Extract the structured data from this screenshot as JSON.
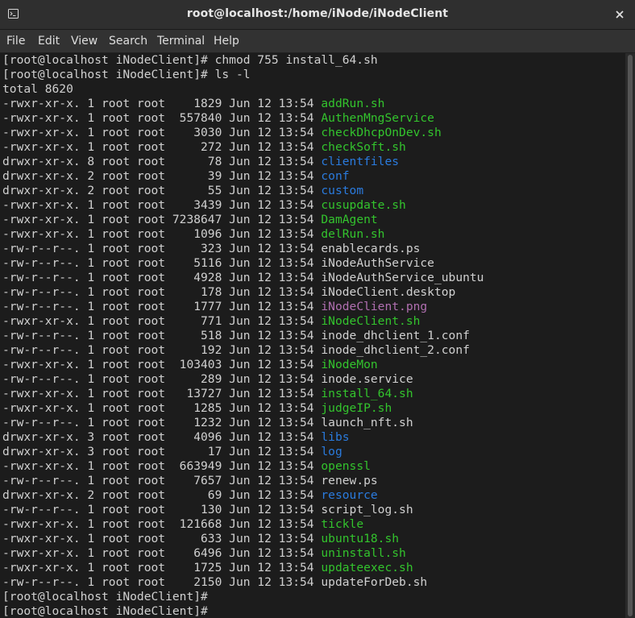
{
  "window": {
    "title": "root@localhost:/home/iNode/iNodeClient"
  },
  "menu": {
    "items": [
      "File",
      "Edit",
      "View",
      "Search",
      "Terminal",
      "Help"
    ]
  },
  "colors": {
    "exec": "#33c42d",
    "dir": "#2a7bde",
    "image": "#b06fb0",
    "plain": "#d0d0d0"
  },
  "terminal": {
    "lines": [
      {
        "prefix": "[root@localhost iNodeClient]# chmod 755 install_64.sh",
        "name": "",
        "kind": "plain"
      },
      {
        "prefix": "[root@localhost iNodeClient]# ls -l",
        "name": "",
        "kind": "plain"
      },
      {
        "prefix": "total 8620",
        "name": "",
        "kind": "plain"
      },
      {
        "prefix": "-rwxr-xr-x. 1 root root    1829 Jun 12 13:54 ",
        "name": "addRun.sh",
        "kind": "exec"
      },
      {
        "prefix": "-rwxr-xr-x. 1 root root  557840 Jun 12 13:54 ",
        "name": "AuthenMngService",
        "kind": "exec"
      },
      {
        "prefix": "-rwxr-xr-x. 1 root root    3030 Jun 12 13:54 ",
        "name": "checkDhcpOnDev.sh",
        "kind": "exec"
      },
      {
        "prefix": "-rwxr-xr-x. 1 root root     272 Jun 12 13:54 ",
        "name": "checkSoft.sh",
        "kind": "exec"
      },
      {
        "prefix": "drwxr-xr-x. 8 root root      78 Jun 12 13:54 ",
        "name": "clientfiles",
        "kind": "dir"
      },
      {
        "prefix": "drwxr-xr-x. 2 root root      39 Jun 12 13:54 ",
        "name": "conf",
        "kind": "dir"
      },
      {
        "prefix": "drwxr-xr-x. 2 root root      55 Jun 12 13:54 ",
        "name": "custom",
        "kind": "dir"
      },
      {
        "prefix": "-rwxr-xr-x. 1 root root    3439 Jun 12 13:54 ",
        "name": "cusupdate.sh",
        "kind": "exec"
      },
      {
        "prefix": "-rwxr-xr-x. 1 root root 7238647 Jun 12 13:54 ",
        "name": "DamAgent",
        "kind": "exec"
      },
      {
        "prefix": "-rwxr-xr-x. 1 root root    1096 Jun 12 13:54 ",
        "name": "delRun.sh",
        "kind": "exec"
      },
      {
        "prefix": "-rw-r--r--. 1 root root     323 Jun 12 13:54 ",
        "name": "enablecards.ps",
        "kind": "plain"
      },
      {
        "prefix": "-rw-r--r--. 1 root root    5116 Jun 12 13:54 ",
        "name": "iNodeAuthService",
        "kind": "plain"
      },
      {
        "prefix": "-rw-r--r--. 1 root root    4928 Jun 12 13:54 ",
        "name": "iNodeAuthService_ubuntu",
        "kind": "plain"
      },
      {
        "prefix": "-rw-r--r--. 1 root root     178 Jun 12 13:54 ",
        "name": "iNodeClient.desktop",
        "kind": "plain"
      },
      {
        "prefix": "-rw-r--r--. 1 root root    1777 Jun 12 13:54 ",
        "name": "iNodeClient.png",
        "kind": "image"
      },
      {
        "prefix": "-rwxr-xr-x. 1 root root     771 Jun 12 13:54 ",
        "name": "iNodeClient.sh",
        "kind": "exec"
      },
      {
        "prefix": "-rw-r--r--. 1 root root     518 Jun 12 13:54 ",
        "name": "inode_dhclient_1.conf",
        "kind": "plain"
      },
      {
        "prefix": "-rw-r--r--. 1 root root     192 Jun 12 13:54 ",
        "name": "inode_dhclient_2.conf",
        "kind": "plain"
      },
      {
        "prefix": "-rwxr-xr-x. 1 root root  103403 Jun 12 13:54 ",
        "name": "iNodeMon",
        "kind": "exec"
      },
      {
        "prefix": "-rw-r--r--. 1 root root     289 Jun 12 13:54 ",
        "name": "inode.service",
        "kind": "plain"
      },
      {
        "prefix": "-rwxr-xr-x. 1 root root   13727 Jun 12 13:54 ",
        "name": "install_64.sh",
        "kind": "exec"
      },
      {
        "prefix": "-rwxr-xr-x. 1 root root    1285 Jun 12 13:54 ",
        "name": "judgeIP.sh",
        "kind": "exec"
      },
      {
        "prefix": "-rw-r--r--. 1 root root    1232 Jun 12 13:54 ",
        "name": "launch_nft.sh",
        "kind": "plain"
      },
      {
        "prefix": "drwxr-xr-x. 3 root root    4096 Jun 12 13:54 ",
        "name": "libs",
        "kind": "dir"
      },
      {
        "prefix": "drwxr-xr-x. 3 root root      17 Jun 12 13:54 ",
        "name": "log",
        "kind": "dir"
      },
      {
        "prefix": "-rwxr-xr-x. 1 root root  663949 Jun 12 13:54 ",
        "name": "openssl",
        "kind": "exec"
      },
      {
        "prefix": "-rw-r--r--. 1 root root    7657 Jun 12 13:54 ",
        "name": "renew.ps",
        "kind": "plain"
      },
      {
        "prefix": "drwxr-xr-x. 2 root root      69 Jun 12 13:54 ",
        "name": "resource",
        "kind": "dir"
      },
      {
        "prefix": "-rw-r--r--. 1 root root     130 Jun 12 13:54 ",
        "name": "script_log.sh",
        "kind": "plain"
      },
      {
        "prefix": "-rwxr-xr-x. 1 root root  121668 Jun 12 13:54 ",
        "name": "tickle",
        "kind": "exec"
      },
      {
        "prefix": "-rwxr-xr-x. 1 root root     633 Jun 12 13:54 ",
        "name": "ubuntu18.sh",
        "kind": "exec"
      },
      {
        "prefix": "-rwxr-xr-x. 1 root root    6496 Jun 12 13:54 ",
        "name": "uninstall.sh",
        "kind": "exec"
      },
      {
        "prefix": "-rwxr-xr-x. 1 root root    1725 Jun 12 13:54 ",
        "name": "updateexec.sh",
        "kind": "exec"
      },
      {
        "prefix": "-rw-r--r--. 1 root root    2150 Jun 12 13:54 ",
        "name": "updateForDeb.sh",
        "kind": "plain"
      },
      {
        "prefix": "[root@localhost iNodeClient]#",
        "name": "",
        "kind": "plain"
      },
      {
        "prefix": "[root@localhost iNodeClient]#",
        "name": "",
        "kind": "plain"
      }
    ]
  }
}
